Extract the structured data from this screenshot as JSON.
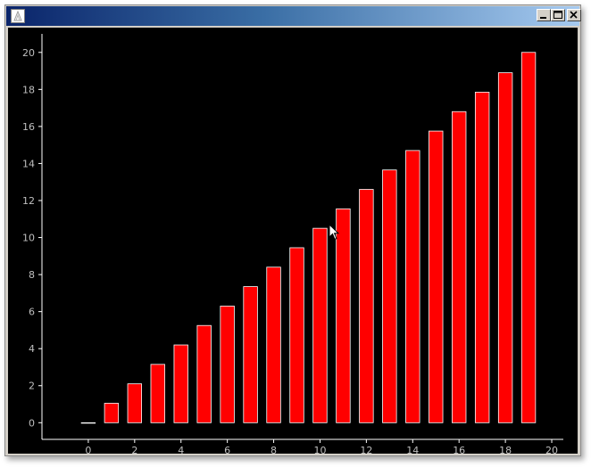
{
  "window": {
    "title": "",
    "icons": {
      "app": "app-logo-icon",
      "minimize": "minimize-icon",
      "maximize": "maximize-icon",
      "close": "close-icon"
    }
  },
  "colors": {
    "plot_background": "#000000",
    "bar_fill": "#ff0000",
    "bar_edge": "#ffffff",
    "axis": "#ffffff",
    "tick_label": "#bfbfbf"
  },
  "chart_data": {
    "type": "bar",
    "title": "",
    "xlabel": "",
    "ylabel": "",
    "x": [
      0,
      1,
      2,
      3,
      4,
      5,
      6,
      7,
      8,
      9,
      10,
      11,
      12,
      13,
      14,
      15,
      16,
      17,
      18,
      19
    ],
    "values": [
      0,
      1.05,
      2.1,
      3.15,
      4.2,
      5.25,
      6.3,
      7.35,
      8.4,
      9.45,
      10.5,
      11.55,
      12.6,
      13.65,
      14.7,
      15.75,
      16.8,
      17.85,
      18.9,
      20
    ],
    "xlim": [
      -2.0,
      20.5
    ],
    "ylim": [
      -0.9,
      21.0
    ],
    "xticks": [
      0,
      2,
      4,
      6,
      8,
      10,
      12,
      14,
      16,
      18,
      20
    ],
    "yticks": [
      0,
      2,
      4,
      6,
      8,
      10,
      12,
      14,
      16,
      18,
      20
    ],
    "bar_width": 0.6,
    "grid": false
  }
}
